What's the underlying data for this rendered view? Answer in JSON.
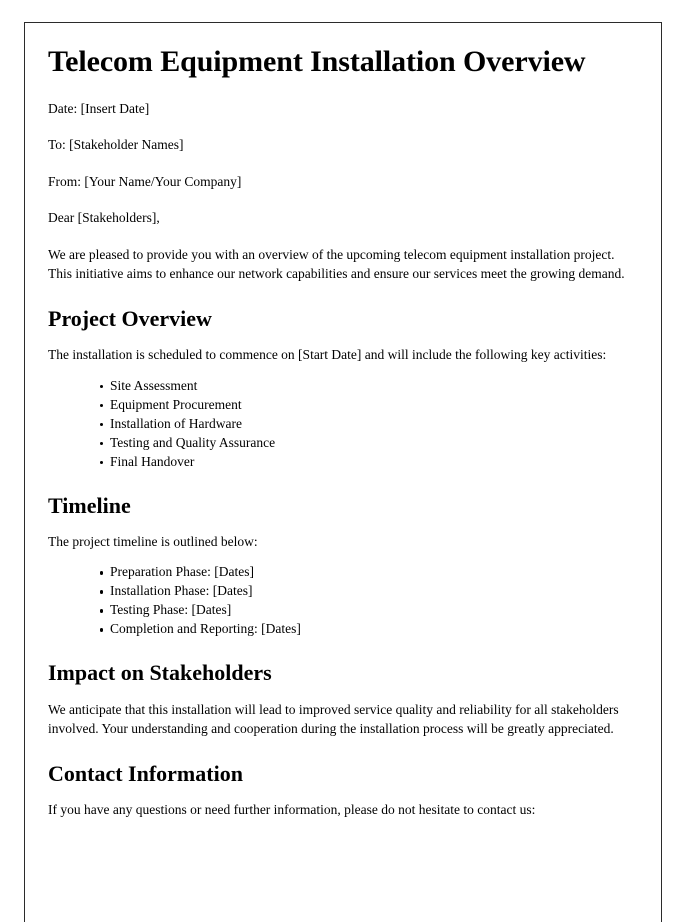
{
  "document": {
    "title": "Telecom Equipment Installation Overview",
    "meta": [
      {
        "label": "date-line",
        "text": "Date: [Insert Date]"
      },
      {
        "label": "to-line",
        "text": "To: [Stakeholder Names]"
      },
      {
        "label": "from-line",
        "text": "From: [Your Name/Your Company]"
      },
      {
        "label": "salutation-line",
        "text": "Dear [Stakeholders],"
      }
    ],
    "intro_paragraph": "We are pleased to provide you with an overview of the upcoming telecom equipment installation project. This initiative aims to enhance our network capabilities and ensure our services meet the growing demand.",
    "sections": {
      "project_overview": {
        "heading": "Project Overview",
        "lead_in": "The installation is scheduled to commence on [Start Date] and will include the following key activities:",
        "items": [
          "Site Assessment",
          "Equipment Procurement",
          "Installation of Hardware",
          "Testing and Quality Assurance",
          "Final Handover"
        ]
      },
      "timeline": {
        "heading": "Timeline",
        "lead_in": "The project timeline is outlined below:",
        "items": [
          "Preparation Phase: [Dates]",
          "Installation Phase: [Dates]",
          "Testing Phase: [Dates]",
          "Completion and Reporting: [Dates]"
        ]
      },
      "impact_on_stakeholders": {
        "heading": "Impact on Stakeholders",
        "paragraph": "We anticipate that this installation will lead to improved service quality and reliability for all stakeholders involved. Your understanding and cooperation during the installation process will be greatly appreciated."
      },
      "contact_information": {
        "heading": "Contact Information",
        "paragraph": "If you have any questions or need further information, please do not hesitate to contact us:"
      }
    }
  }
}
